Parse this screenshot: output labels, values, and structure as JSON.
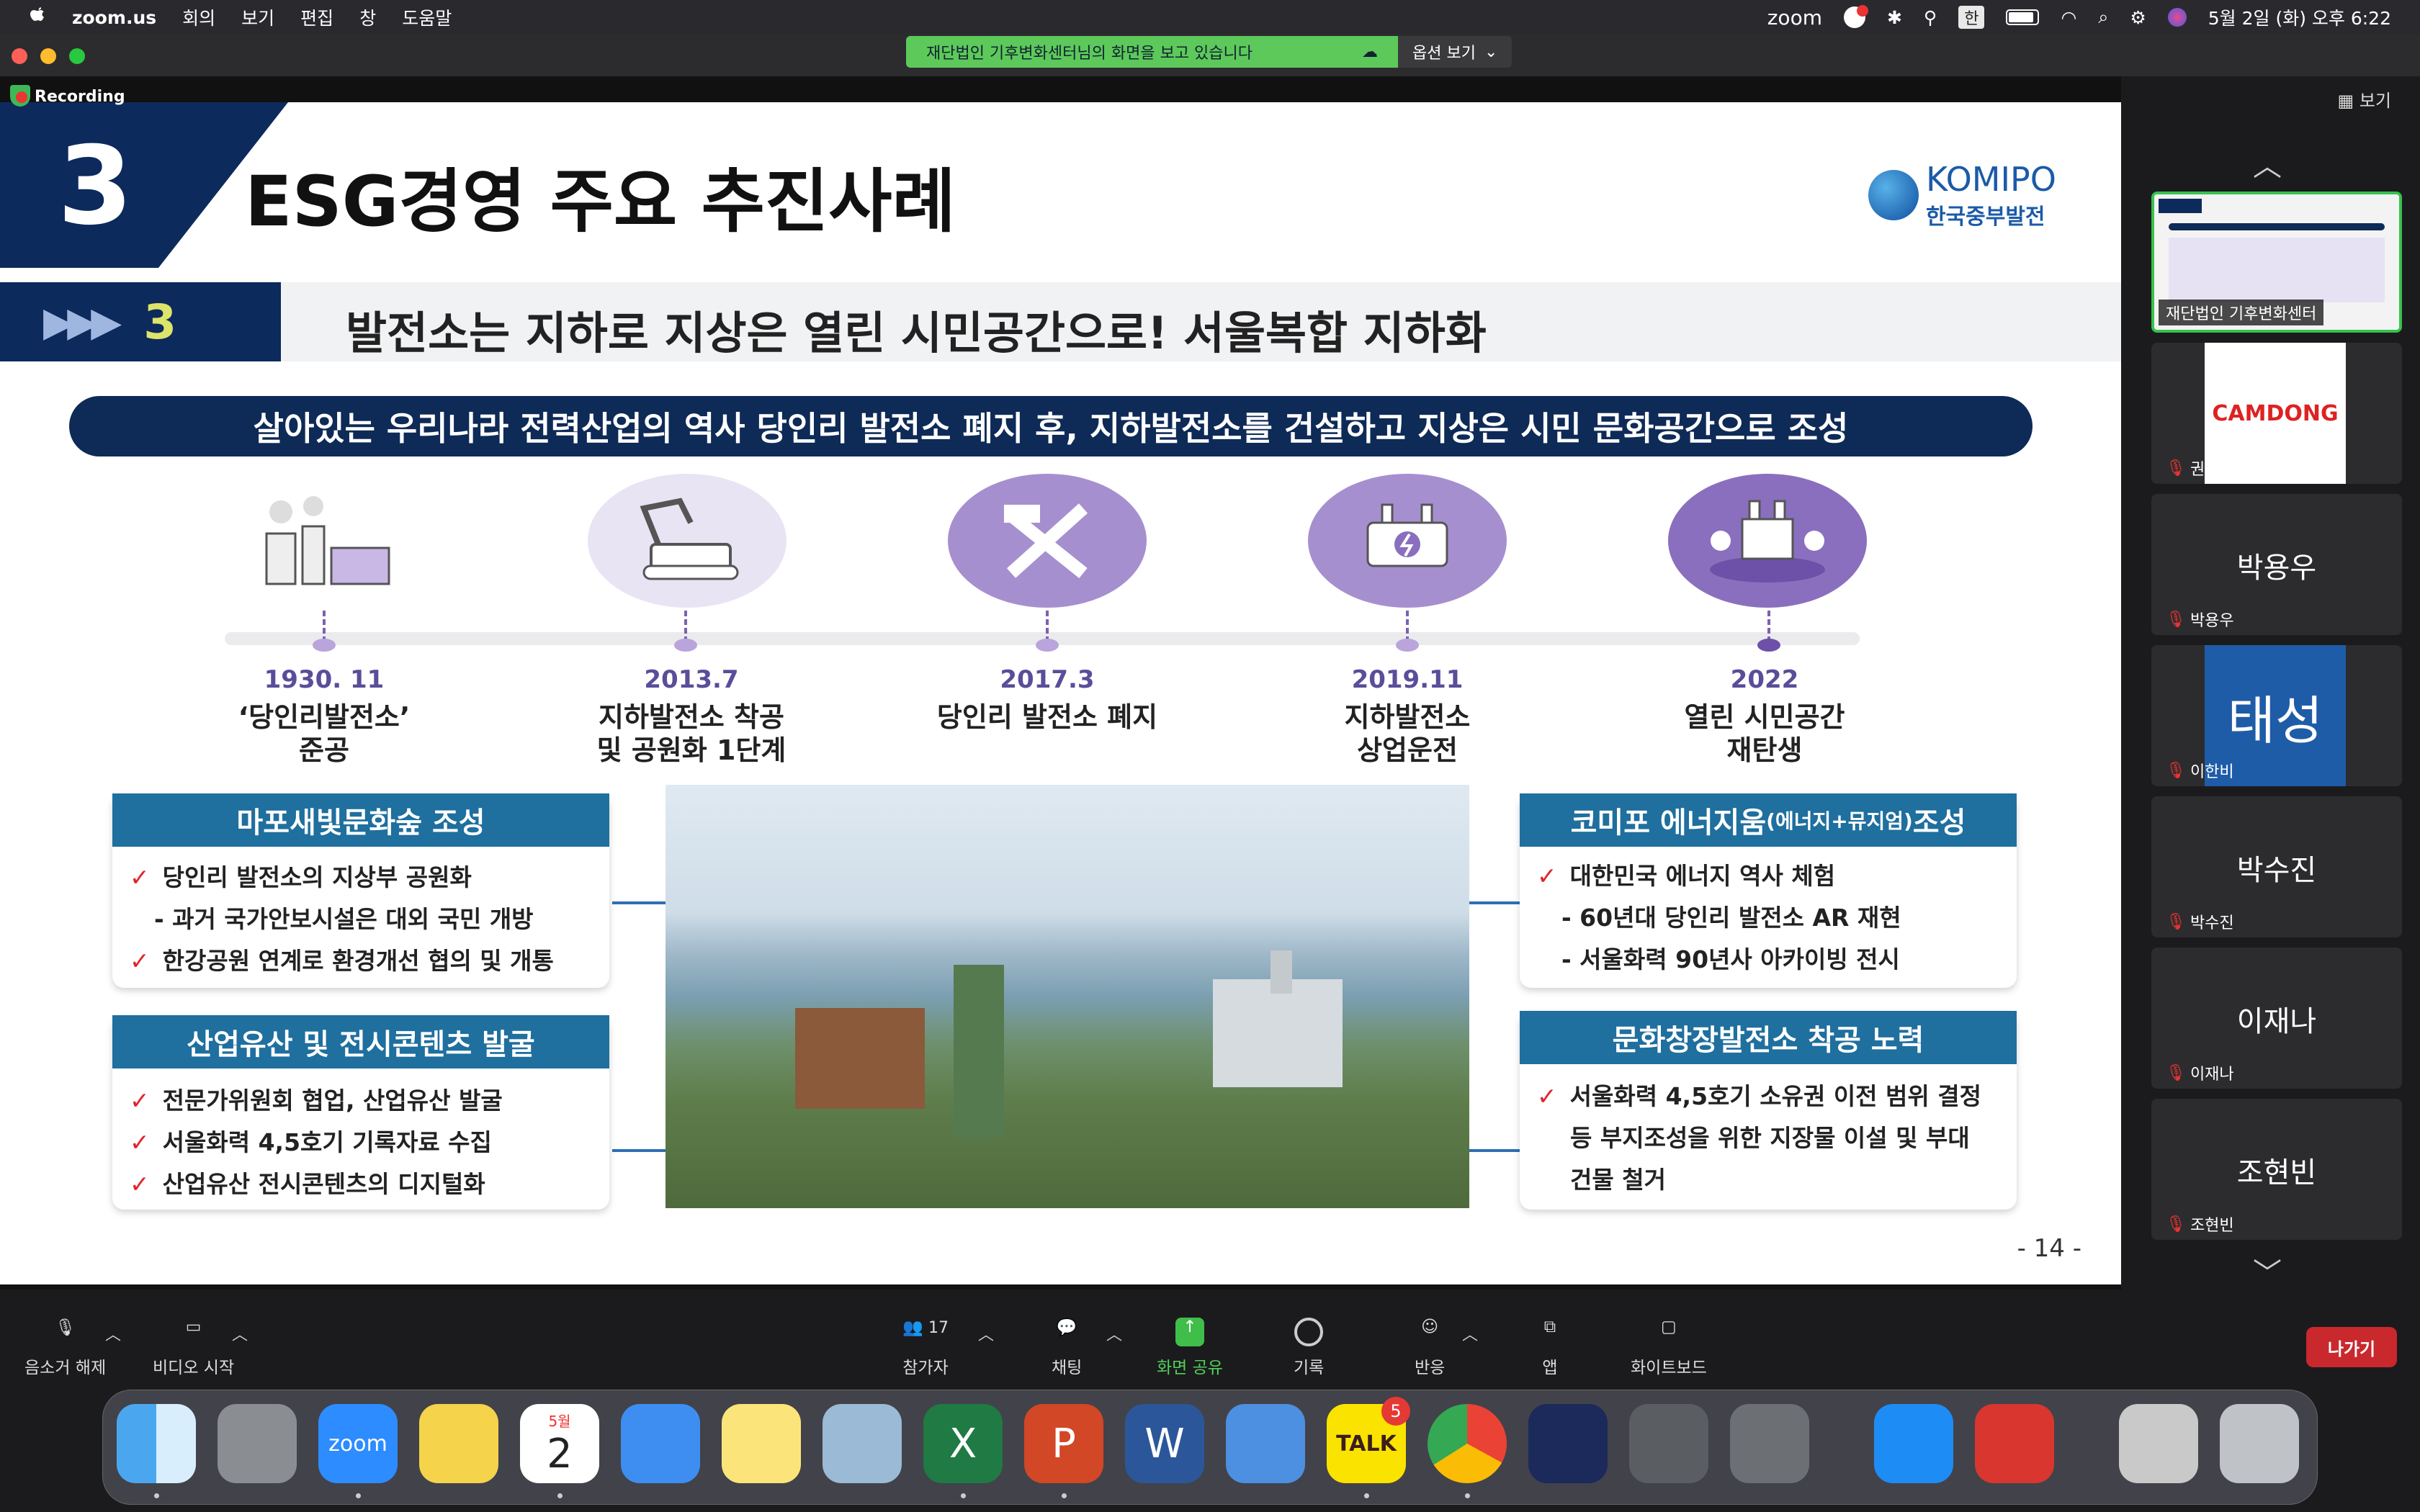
{
  "menubar": {
    "app": "zoom.us",
    "items": [
      "회의",
      "보기",
      "편집",
      "창",
      "도움말"
    ],
    "zoom_label": "zoom",
    "han": "한",
    "datetime": "5월 2일 (화) 오후 6:22"
  },
  "share": {
    "message": "재단법인 기후변화센터님의 화면을 보고 있습니다",
    "options": "옵션 보기"
  },
  "recording": "Recording",
  "slide": {
    "num": "3",
    "title": "ESG경영 주요 추진사례",
    "logo_en": "KOMIPO",
    "logo_ko": "한국중부발전",
    "section_num": "3",
    "section_title": "발전소는 지하로 지상은 열린 시민공간으로! 서울복합 지하화",
    "banner": "살아있는 우리나라 전력산업의 역사 당인리 발전소 폐지 후, 지하발전소를 건설하고 지상은 시민 문화공간으로 조성",
    "timeline": [
      {
        "year": "1930. 11",
        "l1": "‘당인리발전소’",
        "l2": "준공"
      },
      {
        "year": "2013.7",
        "l1": "지하발전소 착공",
        "l2": "및 공원화 1단계"
      },
      {
        "year": "2017.3",
        "l1": "당인리 발전소 폐지",
        "l2": ""
      },
      {
        "year": "2019.11",
        "l1": "지하발전소",
        "l2": "상업운전"
      },
      {
        "year": "2022",
        "l1": "열린 시민공간",
        "l2": "재탄생"
      }
    ],
    "box1": {
      "head": "마포새빛문화숲 조성",
      "lines": [
        "당인리 발전소의 지상부 공원화",
        "- 과거 국가안보시설은 대외 국민 개방",
        "한강공원 연계로 환경개선 협의 및 개통"
      ]
    },
    "box2": {
      "head": "산업유산 및 전시콘텐츠 발굴",
      "lines": [
        "전문가위원회 협업, 산업유산 발굴",
        "서울화력 4,5호기 기록자료 수집",
        "산업유산 전시콘텐츠의 디지털화"
      ]
    },
    "box3": {
      "head": "코미포 에너지움",
      "head_small": "(에너지+뮤지엄)",
      "head_tail": "조성",
      "lines": [
        "대한민국 에너지 역사 체험",
        "- 60년대 당인리 발전소 AR 재현",
        "- 서울화력 90년사 아카이빙 전시"
      ]
    },
    "box4": {
      "head": "문화창장발전소 착공 노력",
      "lines": [
        "서울화력 4,5호기 소유권 이전 범위 결정",
        "등 부지조성을 위한 지장물 이설 및 부대",
        "건물 철거"
      ]
    },
    "page": "- 14 -"
  },
  "sidebar": {
    "view": "보기",
    "tiles": [
      {
        "name": "재단법인 기후변화센터",
        "type": "thumb"
      },
      {
        "name": "권현진",
        "type": "logo",
        "logo": "CAMDONG"
      },
      {
        "name": "박용우",
        "type": "text",
        "big": "박용우"
      },
      {
        "name": "이한비",
        "type": "blue",
        "big": "태성"
      },
      {
        "name": "박수진",
        "type": "text",
        "big": "박수진"
      },
      {
        "name": "이재나",
        "type": "text",
        "big": "이재나"
      },
      {
        "name": "조현빈",
        "type": "text",
        "big": "조현빈"
      }
    ]
  },
  "toolbar": {
    "mute": "음소거 해제",
    "video": "비디오 시작",
    "participants": "참가자",
    "participants_count": "17",
    "chat": "채팅",
    "share": "화면 공유",
    "record": "기록",
    "reactions": "반응",
    "apps": "앱",
    "whiteboard": "화이트보드",
    "leave": "나가기"
  },
  "dock": {
    "calendar_month": "5월",
    "calendar_day": "2",
    "talk_badge": "5",
    "zoom_label": "zoom",
    "talk_label": "TALK"
  },
  "colors": {
    "navy": "#0d2a5c",
    "teal_head": "#1f6f9f",
    "purple": "#8a6fbe",
    "green": "#5cc95a",
    "leave": "#c9282d"
  }
}
